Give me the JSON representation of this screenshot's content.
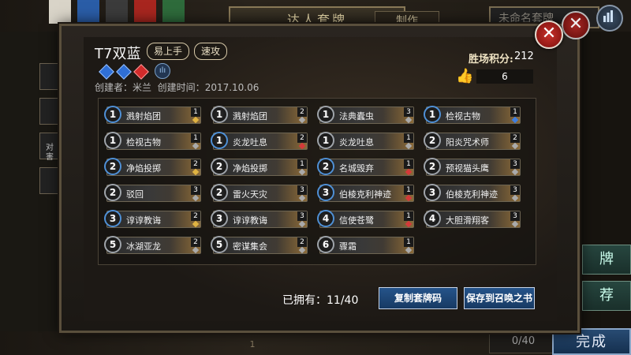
{
  "background": {
    "title_banner": "达人套牌",
    "made_tab": "制作",
    "deck_name_placeholder": "未命名套牌",
    "side_buttons": [
      "牌",
      "荐"
    ],
    "card_count": "0/40",
    "finish_label": "完成",
    "page_indicator": "1",
    "left_texts": [
      "对",
      "害"
    ]
  },
  "deck": {
    "title": "T7双蓝",
    "tags": [
      "易上手",
      "速攻"
    ],
    "creator_label": "创建者：",
    "creator": "米兰",
    "created_label": "创建时间：",
    "created_date": "2017.10.06",
    "score_label": "胜场积分:",
    "score": "212",
    "likes": "6",
    "gem_colors": [
      "#2f6fd6",
      "#2f6fd6",
      "#d12b2b"
    ]
  },
  "cards": [
    {
      "cost": "1",
      "name": "溅射焰团",
      "count": "1",
      "cost_color": "blue",
      "rarity": "gold"
    },
    {
      "cost": "1",
      "name": "溅射焰团",
      "count": "2",
      "cost_color": "gray",
      "rarity": "gray"
    },
    {
      "cost": "1",
      "name": "法典蠹虫",
      "count": "3",
      "cost_color": "gray",
      "rarity": "gray"
    },
    {
      "cost": "1",
      "name": "检视古物",
      "count": "1",
      "cost_color": "blue",
      "rarity": "blue"
    },
    {
      "cost": "1",
      "name": "检视古物",
      "count": "1",
      "cost_color": "gray",
      "rarity": "gray"
    },
    {
      "cost": "1",
      "name": "炎龙吐息",
      "count": "2",
      "cost_color": "blue",
      "rarity": "red"
    },
    {
      "cost": "1",
      "name": "炎龙吐息",
      "count": "1",
      "cost_color": "gray",
      "rarity": "gray"
    },
    {
      "cost": "2",
      "name": "阳炎咒术师",
      "count": "2",
      "cost_color": "gray",
      "rarity": "gray"
    },
    {
      "cost": "2",
      "name": "净焰投掷",
      "count": "2",
      "cost_color": "blue",
      "rarity": "gold"
    },
    {
      "cost": "2",
      "name": "净焰投掷",
      "count": "1",
      "cost_color": "gray",
      "rarity": "gray"
    },
    {
      "cost": "2",
      "name": "名城毁弃",
      "count": "1",
      "cost_color": "blue",
      "rarity": "red"
    },
    {
      "cost": "2",
      "name": "预视猫头鹰",
      "count": "3",
      "cost_color": "gray",
      "rarity": "gray"
    },
    {
      "cost": "2",
      "name": "驳回",
      "count": "3",
      "cost_color": "gray",
      "rarity": "gray"
    },
    {
      "cost": "2",
      "name": "雷火天灾",
      "count": "3",
      "cost_color": "gray",
      "rarity": "gray"
    },
    {
      "cost": "3",
      "name": "伯棱克利神迹",
      "count": "1",
      "cost_color": "blue",
      "rarity": "red"
    },
    {
      "cost": "3",
      "name": "伯棱克利神迹",
      "count": "3",
      "cost_color": "gray",
      "rarity": "gray"
    },
    {
      "cost": "3",
      "name": "谆谆教诲",
      "count": "2",
      "cost_color": "blue",
      "rarity": "gold"
    },
    {
      "cost": "3",
      "name": "谆谆教诲",
      "count": "3",
      "cost_color": "gray",
      "rarity": "gray"
    },
    {
      "cost": "4",
      "name": "信使苍鹭",
      "count": "1",
      "cost_color": "blue",
      "rarity": "red"
    },
    {
      "cost": "4",
      "name": "大胆滑翔客",
      "count": "3",
      "cost_color": "gray",
      "rarity": "gray"
    },
    {
      "cost": "5",
      "name": "冰湖亚龙",
      "count": "2",
      "cost_color": "gray",
      "rarity": "gray"
    },
    {
      "cost": "5",
      "name": "密谋集会",
      "count": "2",
      "cost_color": "gray",
      "rarity": "gray"
    },
    {
      "cost": "6",
      "name": "骤霜",
      "count": "1",
      "cost_color": "gray",
      "rarity": "gray"
    }
  ],
  "footer": {
    "owned_label": "已拥有：",
    "owned_value": "11/40",
    "copy_button": "复制套牌码",
    "save_button": "保存到召唤之书"
  }
}
